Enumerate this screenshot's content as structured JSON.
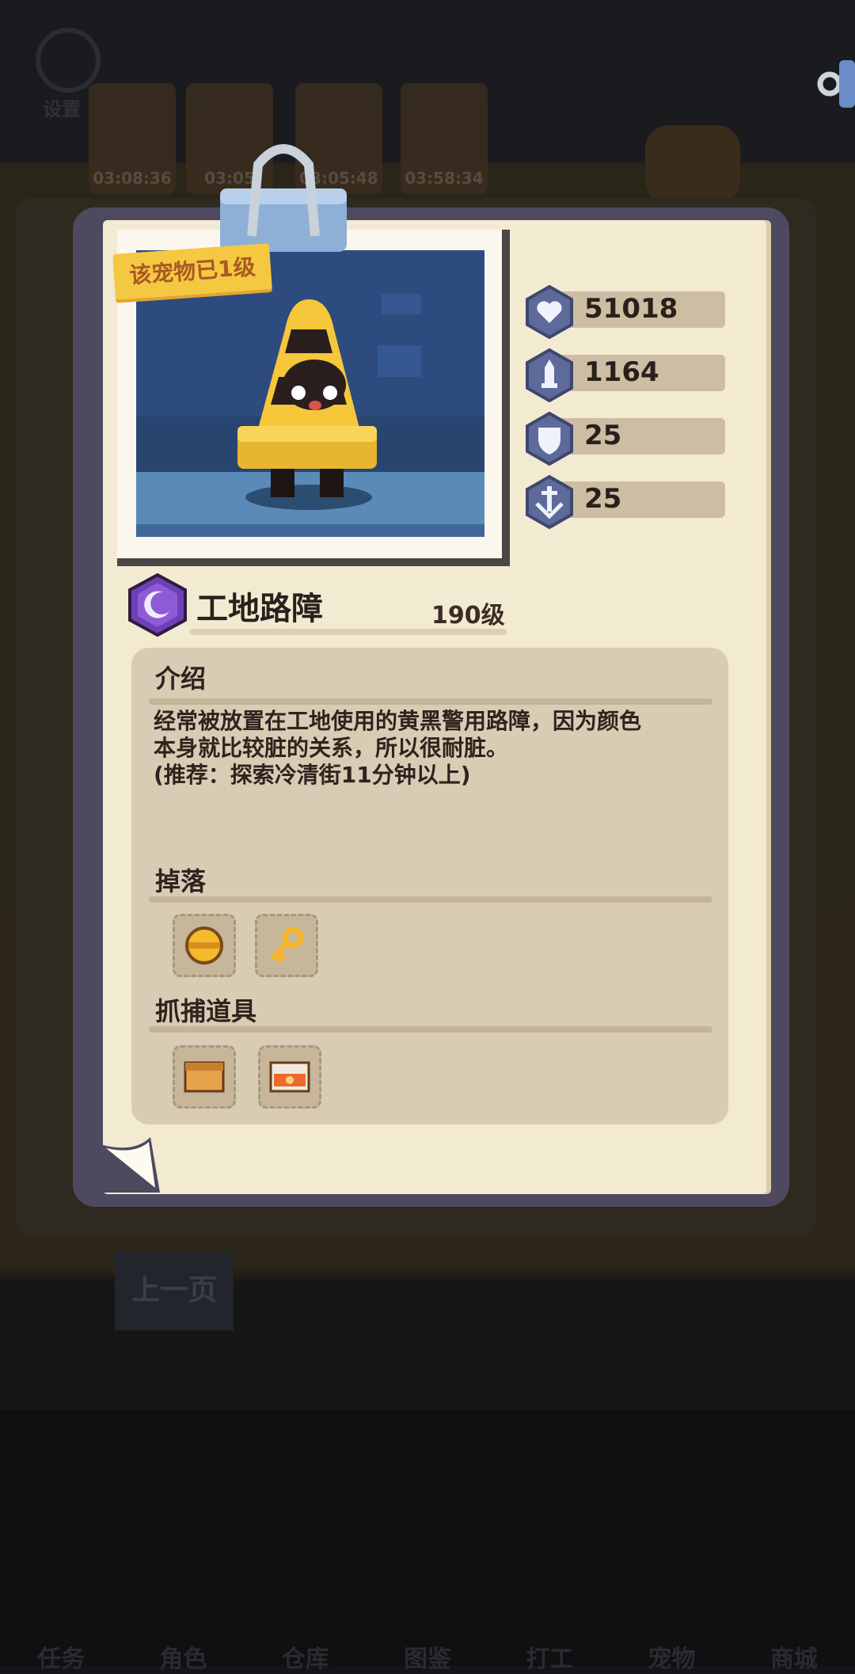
{
  "background": {
    "timers": [
      "03:08:36",
      "03:05",
      "03:05:48",
      "03:58:34"
    ],
    "settings_label": "设置",
    "prev_page_label": "上一页",
    "nav_tabs": [
      "任务",
      "角色",
      "仓库",
      "图鉴",
      "打工",
      "宠物",
      "商城"
    ]
  },
  "pet_card": {
    "ribbon": "该宠物已1级",
    "stats": {
      "hp": "51018",
      "attack": "1164",
      "defense": "25",
      "speed": "25"
    },
    "name": "工地路障",
    "level": "190级",
    "intro_title": "介绍",
    "intro_lines": [
      "经常被放置在工地使用的黄黑警用路障，因为颜色",
      "本身就比较脏的关系，所以很耐脏。",
      "(推荐：探索冷清街11分钟以上)"
    ],
    "drop_title": "掉落",
    "drops": [
      "coin-icon",
      "key-icon"
    ],
    "capture_title": "抓捕道具",
    "capture_tools": [
      "box-icon",
      "cage-icon"
    ]
  },
  "colors": {
    "card_bg": "#f3ead2",
    "panel_bg": "#d8ccb5",
    "ribbon": "#f5c842",
    "hex_icon": "#5d6a9a",
    "rarity_purple": "#6f3fb7"
  }
}
